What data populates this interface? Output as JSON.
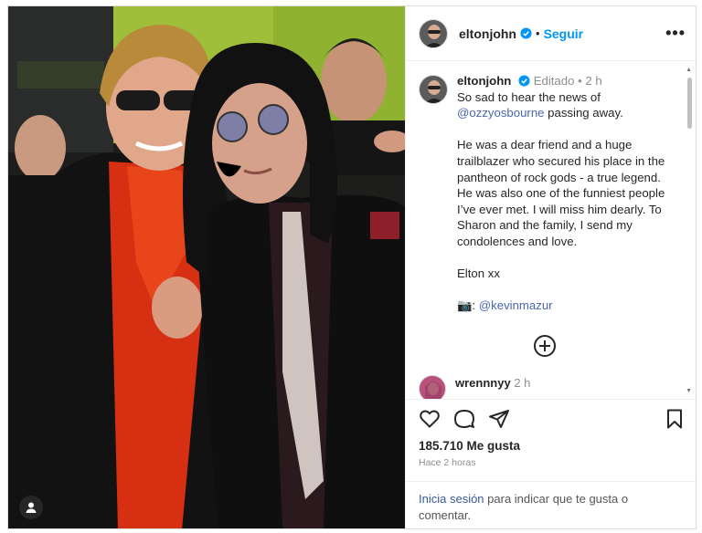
{
  "post": {
    "username": "eltonjohn",
    "follow_label": "Seguir",
    "more_label": "•••",
    "dot": "•"
  },
  "caption": {
    "username": "eltonjohn",
    "edited_label": "Editado",
    "time": "2 h",
    "line1": "So sad to hear the news of",
    "mention": "@ozzyosbourne",
    "line2_rest": " passing away.",
    "paragraph2": [
      "He was a dear friend and a huge",
      "trailblazer who secured his place in the",
      "pantheon of rock gods - a true legend.",
      "He was also one of the funniest people",
      "I’ve ever met. I will miss him dearly. To",
      "Sharon and the family, I send my",
      "condolences and love."
    ],
    "signoff": "Elton xx",
    "camera_emoji": "📷",
    "photo_credit_prefix": ": ",
    "photo_credit": "@kevinmazur"
  },
  "comment_preview": {
    "username": "wrennnyy",
    "time": "2 h"
  },
  "likes": "185.710 Me gusta",
  "post_time": "Hace 2 horas",
  "login": {
    "link": "Inicia sesión",
    "rest_line1": " para indicar que te gusta o",
    "rest_line2": "comentar."
  },
  "icons": {
    "like": "heart-icon",
    "comment": "comment-icon",
    "share": "paper-plane-icon",
    "save": "bookmark-icon",
    "verified": "verified-badge-icon",
    "add_comment": "plus-circle-icon",
    "user_tag": "user-icon"
  },
  "colors": {
    "link_blue": "#0095f6",
    "verified_blue": "#0095f6",
    "muted_gray": "#8e8e8e"
  }
}
